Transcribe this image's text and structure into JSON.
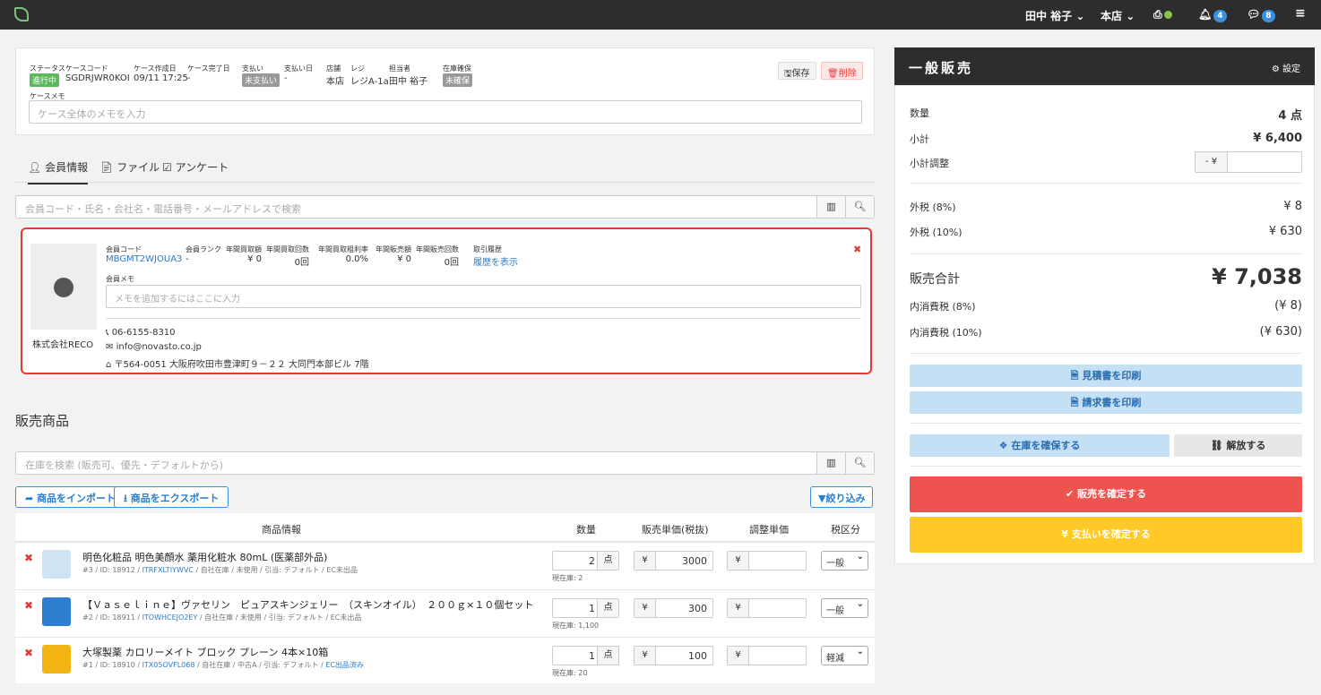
{
  "topbar": {
    "user": "田中 裕子",
    "store": "本店",
    "notifications": "4",
    "messages": "8"
  },
  "case": {
    "status_label": "ステータス",
    "status": "進行中",
    "code_label": "ケースコード",
    "code": "SGDRJWR0KOI",
    "created_label": "ケース作成日",
    "created": "09/11 17:25",
    "completed_label": "ケース完了日",
    "completed": "-",
    "payment_label": "支払い",
    "payment": "未支払い",
    "paydate_label": "支払い日",
    "paydate": "-",
    "store_label": "店舗",
    "store": "本店",
    "register_label": "レジ",
    "register": "レジA-1a",
    "staff_label": "担当者",
    "staff": "田中 裕子",
    "stock_label": "在庫確保",
    "stock": "未確保",
    "memo_label": "ケースメモ",
    "memo_placeholder": "ケース全体のメモを入力",
    "save": "保存",
    "delete": "削除"
  },
  "tabs": [
    "会員情報",
    "ファイル",
    "アンケート"
  ],
  "member_search_placeholder": "会員コード・氏名・会社名・電話番号・メールアドレスで検索",
  "member": {
    "name": "株式会社RECO",
    "code_label": "会員コード",
    "code": "MBGMT2WJOUA3",
    "rank_label": "会員ランク",
    "rank": "-",
    "buy_amount_label": "年間買取額",
    "buy_amount": "¥ 0",
    "buy_count_label": "年間買取回数",
    "buy_count": "0回",
    "margin_label": "年間買取粗利率",
    "margin": "0.0%",
    "sales_amount_label": "年間販売額",
    "sales_amount": "¥ 0",
    "sales_count_label": "年間販売回数",
    "sales_count": "0回",
    "history_label": "取引履歴",
    "history_link": "履歴を表示",
    "memo_label": "会員メモ",
    "memo_placeholder": "メモを追加するにはここに入力",
    "phone": "06-6155-8310",
    "email": "info@novasto.co.jp",
    "address": "〒564-0051 大阪府吹田市豊津町９－２２ 大同門本部ビル 7階"
  },
  "sales_title": "販売商品",
  "stock_search_placeholder": "在庫を検索 (販売可、優先・デフォルトから)",
  "import_label": "商品をインポート",
  "export_label": "商品をエクスポート",
  "filter_label": "絞り込み",
  "table_headers": [
    "商品情報",
    "数量",
    "販売単価(税抜)",
    "調整単価",
    "税区分"
  ],
  "products": [
    {
      "name": "明色化粧品 明色美顔水 薬用化粧水 80mL (医薬部外品)",
      "meta_pre": "#3 / ID: 18912 / ",
      "meta_link": "ITRFXLTIYWVC",
      "meta_post": " / 自社在庫 / 未使用 / 引当: デフォルト / EC未出品",
      "qty": "2",
      "unit": "点",
      "stock": "現在庫: 2",
      "yen": "¥",
      "price": "3000",
      "tax": "一般",
      "thumb": "#cfe3f5"
    },
    {
      "name": "【Ｖａｓｅｌｉｎｅ】ヴァセリン　ピュアスキンジェリー　（スキンオイル）　２００ｇ×１０個セット",
      "meta_pre": "#2 / ID: 18911 / ",
      "meta_link": "ITOWHCEJO2EY",
      "meta_post": " / 自社在庫 / 未使用 / 引当: デフォルト / EC未出品",
      "qty": "1",
      "unit": "点",
      "stock": "現在庫: 1,100",
      "yen": "¥",
      "price": "300",
      "tax": "一般",
      "thumb": "#2f7fd0"
    },
    {
      "name": "大塚製薬 カロリーメイト ブロック プレーン 4本×10箱",
      "meta_pre": "#1 / ID: 18910 / ",
      "meta_link": "ITX05OVFL068",
      "meta_post": " / 自社在庫 / 中古A / 引当: デフォルト / ",
      "meta_link2": "EC出品済み",
      "qty": "1",
      "unit": "点",
      "stock": "現在庫: 20",
      "yen": "¥",
      "price": "100",
      "tax": "軽減",
      "thumb": "#f2b514"
    }
  ],
  "summary": {
    "title": "一般販売",
    "settings": "設定",
    "qty_label": "数量",
    "qty": "4 点",
    "subtotal_label": "小計",
    "subtotal": "¥ 6,400",
    "adjust_label": "小計調整",
    "adjust_prefix": "- ¥",
    "tax8_label": "外税 (8%)",
    "tax8": "¥ 8",
    "tax10_label": "外税 (10%)",
    "tax10": "¥ 630",
    "total_label": "販売合計",
    "total": "¥ 7,038",
    "intax8_label": "内消費税 (8%)",
    "intax8": "(¥ 8)",
    "intax10_label": "内消費税 (10%)",
    "intax10": "(¥ 630)",
    "estimate_btn": "見積書を印刷",
    "invoice_btn": "請求書を印刷",
    "reserve_btn": "在庫を確保する",
    "release_btn": "解放する",
    "confirm_sale_btn": "販売を確定する",
    "confirm_pay_btn": "¥ 支払いを確定する"
  },
  "colors": {
    "accent": "#3b8fe0",
    "danger": "#ef5350",
    "warning": "#ffca28",
    "status_green": "#5cb85c",
    "dark": "#2d2d2d"
  }
}
